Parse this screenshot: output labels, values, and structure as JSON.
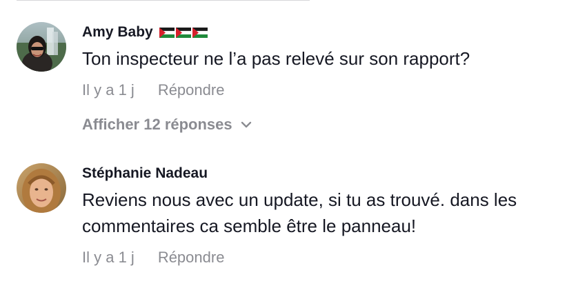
{
  "comments": [
    {
      "author": "Amy Baby",
      "flags": [
        "palestine-flag",
        "palestine-flag",
        "palestine-flag"
      ],
      "text": "Ton inspecteur ne l’a pas relevé sur son rapport?",
      "time": "Il y a 1 j",
      "reply_label": "Répondre",
      "view_replies_label": "Afficher 12 réponses",
      "view_replies_icon": "chevron-down-icon"
    },
    {
      "author": "Stéphanie Nadeau",
      "text": "Reviens nous avec un update, si tu as trouvé. dans les commentaires ca semble être le panneau!",
      "time": "Il y a 1 j",
      "reply_label": "Répondre"
    }
  ],
  "colors": {
    "primary_text": "#161823",
    "secondary_text": "#8a8b91",
    "divider": "#d6d6d8"
  }
}
